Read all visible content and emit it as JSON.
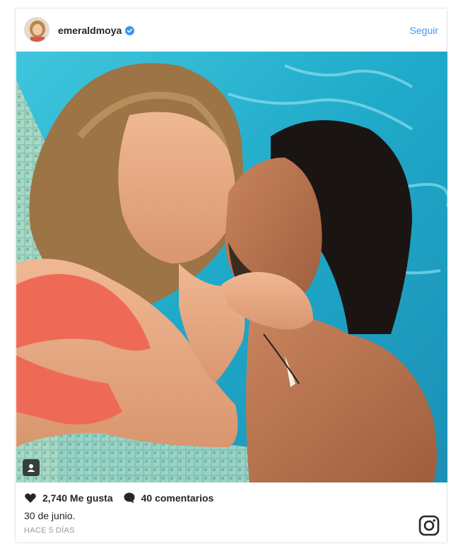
{
  "post": {
    "username": "emeraldmoya",
    "follow_label": "Seguir",
    "likes_label": "2,740 Me gusta",
    "comments_label": "40 comentarios",
    "caption": "30 de junio.",
    "time_ago": "HACE 5 DÍAS"
  },
  "icons": {
    "verified": "verified-badge-icon",
    "like": "heart-icon",
    "comment": "speech-bubble-icon",
    "tag": "user-tag-icon",
    "brand": "instagram-logo-icon"
  },
  "colors": {
    "link": "#3897f0",
    "verified": "#3897f0",
    "text": "#262626",
    "muted": "#999999"
  }
}
